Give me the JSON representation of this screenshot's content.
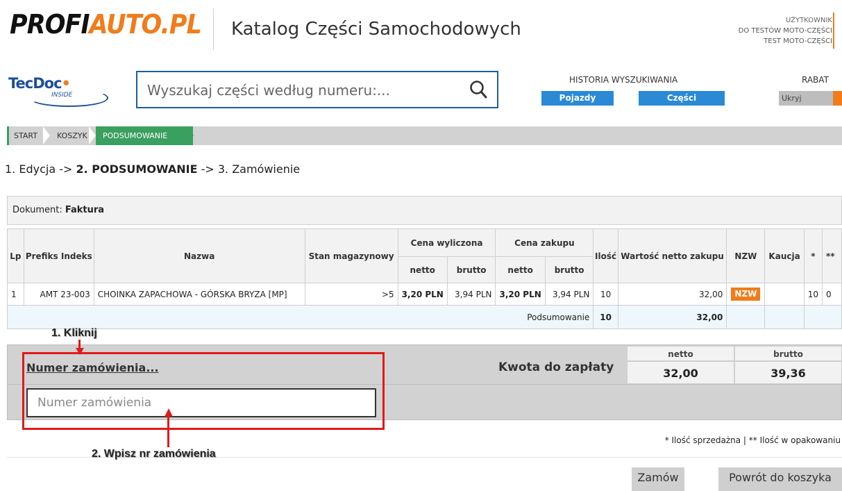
{
  "header": {
    "logo_part1": "PROFI",
    "logo_part2": "AUTO.PL",
    "catalog_title": "Katalog Części Samochodowych",
    "user_label": "UŻYTKOWNIK",
    "user_line1": "DO TESTÓW MOTO-CZĘŚCI",
    "user_line2": "TEST MOTO-CZĘŚCI"
  },
  "tecdoc": {
    "brand": "TecDoc",
    "sub": "INSIDE"
  },
  "search": {
    "placeholder": "Wyszukaj części według numeru:..."
  },
  "history": {
    "label": "HISTORIA WYSZUKIWANIA",
    "vehicles": "Pojazdy",
    "parts": "Części"
  },
  "rabat": {
    "label": "RABAT",
    "toggle": "Ukryj"
  },
  "breadcrumb": {
    "start": "START",
    "koszyk": "KOSZYK",
    "active": "PODSUMOWANIE"
  },
  "steps": {
    "s1": "1. Edycja -> ",
    "s2": "2. PODSUMOWANIE",
    "s3": " -> 3. Zamówienie"
  },
  "document": {
    "label": "Dokument: ",
    "value": "Faktura"
  },
  "table": {
    "headers": {
      "lp": "Lp",
      "prefix": "Prefiks Indeks",
      "name": "Nazwa",
      "stock": "Stan magazynowy",
      "calc_price": "Cena wyliczona",
      "purchase_price": "Cena zakupu",
      "netto": "netto",
      "brutto": "brutto",
      "qty": "Ilość",
      "net_value": "Wartość netto zakupu",
      "nzw": "NZW",
      "kaucja": "Kaucja",
      "star1": "*",
      "star2": "**"
    },
    "rows": [
      {
        "lp": "1",
        "prefix": "AMT 23-003",
        "name": "CHOINKA ZAPACHOWA - GÓRSKA BRYZA [MP]",
        "stock": ">5",
        "calc_netto": "3,20 PLN",
        "calc_brutto": "3,94 PLN",
        "buy_netto": "3,20 PLN",
        "buy_brutto": "3,94 PLN",
        "qty": "10",
        "net_value": "32,00",
        "nzw": "NZW",
        "kaucja": "",
        "star1": "10",
        "star2": "0"
      }
    ],
    "summary": {
      "label": "Podsumowanie",
      "qty": "10",
      "net_value": "32,00"
    }
  },
  "payment": {
    "order_link": "Numer zamówienia...",
    "order_placeholder": "Numer zamówienia",
    "kwota_label": "Kwota do zapłaty",
    "netto_label": "netto",
    "brutto_label": "brutto",
    "netto_value": "32,00",
    "brutto_value": "39,36"
  },
  "legend": "* Ilość sprzedażna | ** Ilość w opakowaniu",
  "buttons": {
    "order": "Zamów",
    "back": "Powrót do koszyka"
  },
  "annotations": {
    "step1": "1. Kliknij",
    "step2": "2. Wpisz nr zamówienia"
  },
  "colors": {
    "accent_orange": "#f07c1b",
    "button_blue": "#2a8ad6",
    "breadcrumb_green": "#3aa05f",
    "annotation_red": "#e11a1a"
  }
}
